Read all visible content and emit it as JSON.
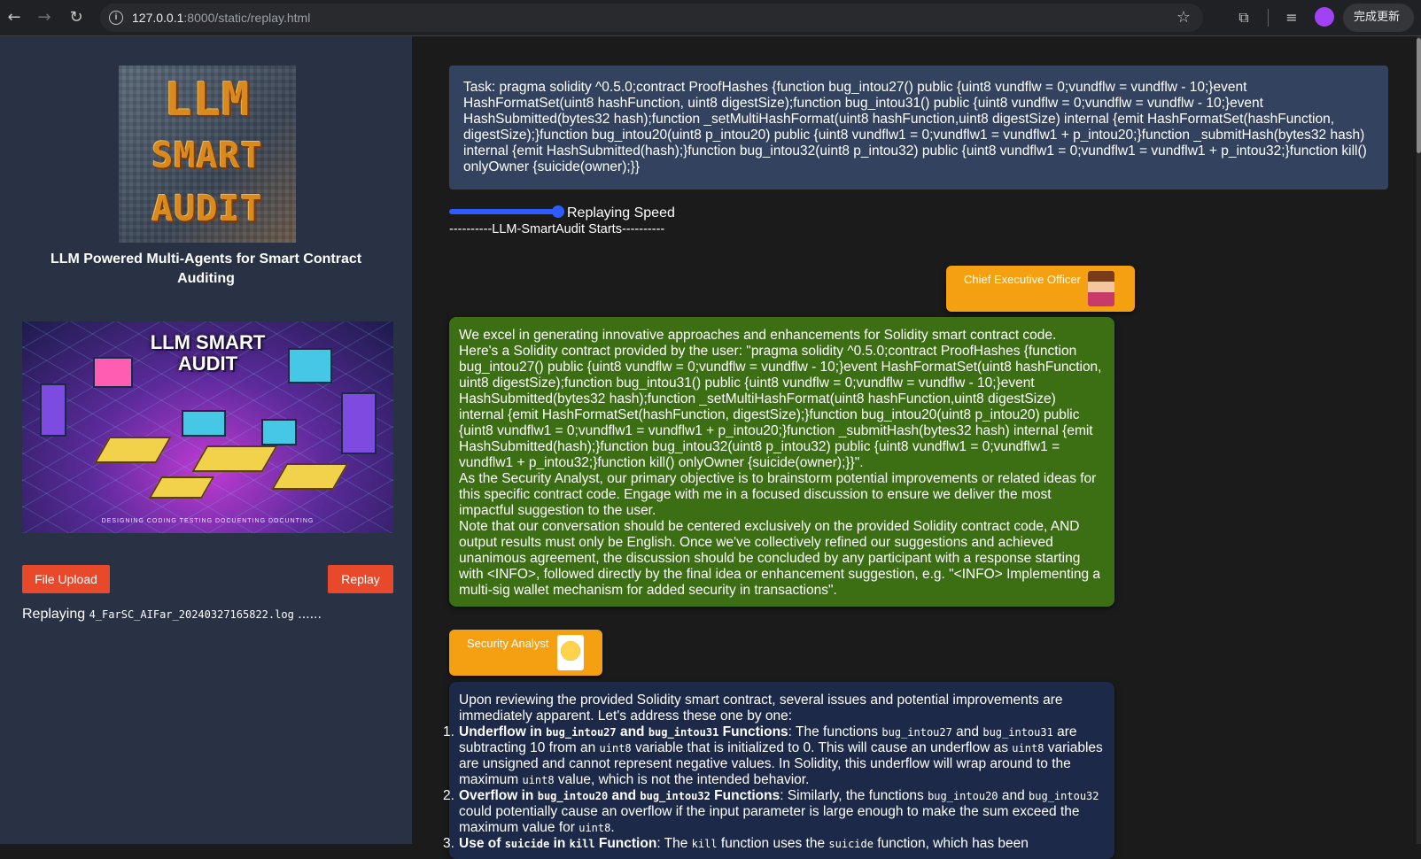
{
  "browser": {
    "url_host": "127.0.0.1",
    "url_rest": ":8000/static/replay.html",
    "update_label": "完成更新",
    "icons": [
      "back-icon",
      "forward-icon",
      "reload-icon",
      "site-info-icon",
      "bookmark-star-icon",
      "extensions-icon",
      "media-control-icon",
      "profile-icon",
      "menu-icon"
    ]
  },
  "sidebar": {
    "logo_words": [
      "LLM",
      "SMART",
      "AUDIT"
    ],
    "tagline": "LLM Powered Multi-Agents for Smart Contract Auditing",
    "banner_title_1": "LLM SMART",
    "banner_title_2": "AUDIT",
    "banner_footer": "DESIGNING   CODING  TESTING  DOCUENTING DOCUNTING",
    "file_upload_label": "File Upload",
    "replay_label": "Replay",
    "status_prefix": "Replaying",
    "status_file": "4_FarSC_AIFar_20240327165822.log",
    "status_suffix": "......"
  },
  "main": {
    "task_text": "Task: pragma solidity ^0.5.0;contract ProofHashes {function bug_intou27() public {uint8 vundflw = 0;vundflw = vundflw - 10;}event HashFormatSet(uint8 hashFunction, uint8 digestSize);function bug_intou31() public {uint8 vundflw = 0;vundflw = vundflw - 10;}event HashSubmitted(bytes32 hash);function _setMultiHashFormat(uint8 hashFunction,uint8 digestSize) internal {emit HashFormatSet(hashFunction, digestSize);}function bug_intou20(uint8 p_intou20) public {uint8 vundflw1 = 0;vundflw1 = vundflw1 + p_intou20;}function _submitHash(bytes32 hash) internal {emit HashSubmitted(hash);}function bug_intou32(uint8 p_intou32) public {uint8 vundflw1 = 0;vundflw1 = vundflw1 + p_intou32;}function kill() onlyOwner {suicide(owner);}}",
    "speed_label": "Replaying Speed",
    "speed_value": 1.0,
    "starts_label": "----------LLM-SmartAudit Starts----------",
    "ceo_role": "Chief Executive Officer",
    "ceo_message": [
      "We excel in generating innovative approaches and enhancements for Solidity smart contract code.",
      "Here's a Solidity contract provided by the user: \"pragma solidity ^0.5.0;contract ProofHashes {function bug_intou27() public {uint8 vundflw = 0;vundflw = vundflw - 10;}event HashFormatSet(uint8 hashFunction, uint8 digestSize);function bug_intou31() public {uint8 vundflw = 0;vundflw = vundflw - 10;}event HashSubmitted(bytes32 hash);function _setMultiHashFormat(uint8 hashFunction,uint8 digestSize) internal {emit HashFormatSet(hashFunction, digestSize);}function bug_intou20(uint8 p_intou20) public {uint8 vundflw1 = 0;vundflw1 = vundflw1 + p_intou20;}function _submitHash(bytes32 hash) internal {emit HashSubmitted(hash);}function bug_intou32(uint8 p_intou32) public {uint8 vundflw1 = 0;vundflw1 = vundflw1 + p_intou32;}function kill() onlyOwner {suicide(owner);}}\".",
      "As the Security Analyst, our primary objective is to brainstorm potential improvements or related ideas for this specific contract code. Engage with me in a focused discussion to ensure we deliver the most impactful suggestion to the user.",
      "Note that our conversation should be centered exclusively on the provided Solidity contract code, AND output results must only be English. Once we've collectively refined our suggestions and achieved unanimous agreement, the discussion should be concluded by any participant with a response starting with <INFO>, followed directly by the final idea or enhancement suggestion, e.g. \"<INFO> Implementing a multi-sig wallet mechanism for added security in transactions\"."
    ],
    "analyst_role": "Security Analyst",
    "analyst_intro": "Upon reviewing the provided Solidity smart contract, several issues and potential improvements are immediately apparent. Let's address these one by one:",
    "analyst_items": [
      {
        "num": "1.",
        "t_underflow": "Underflow in ",
        "c1": "bug_intou27",
        "t_and": " and ",
        "c2": "bug_intou31",
        "t_functions": " Functions",
        "t_a": ": The functions ",
        "c3": "bug_intou27",
        "t_b": " and ",
        "c4": "bug_intou31",
        "t_c": " are subtracting 10 from an ",
        "c5": "uint8",
        "t_d": " variable that is initialized to 0. This will cause an underflow as ",
        "c6": "uint8",
        "t_e": " variables are unsigned and cannot represent negative values. In Solidity, this underflow will wrap around to the maximum ",
        "c7": "uint8",
        "t_f": " value, which is not the intended behavior."
      },
      {
        "num": "2.",
        "t_overflow": "Overflow in ",
        "c1": "bug_intou20",
        "t_and": " and ",
        "c2": "bug_intou32",
        "t_functions": " Functions",
        "t_a": ": Similarly, the functions ",
        "c3": "bug_intou20",
        "t_b": " and ",
        "c4": "bug_intou32",
        "t_c": " could potentially cause an overflow if the input parameter is large enough to make the sum exceed the maximum value for ",
        "c5": "uint8",
        "t_d": "."
      },
      {
        "num": "3.",
        "t_use": "Use of ",
        "c1": "suicide",
        "t_in": " in ",
        "c2": "kill",
        "t_function": " Function",
        "t_a": ": The ",
        "c3": "kill",
        "t_b": " function uses the ",
        "c4": "suicide",
        "t_c": " function, which has been"
      }
    ]
  }
}
